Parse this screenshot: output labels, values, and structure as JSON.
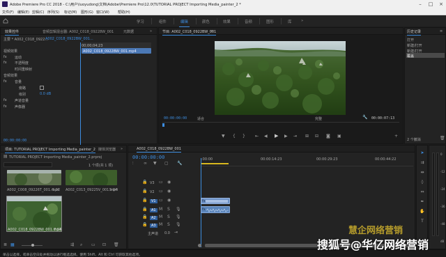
{
  "titlebar": {
    "title": "Adobe Premiere Pro CC 2018 - C:\\用户\\luoyudong\\文档\\Adobe\\Premiere Pro\\12.0\\TUTORIAL PROJECT Importing Media_painter_2 *"
  },
  "menu": [
    "文件(F)",
    "编辑(E)",
    "剪辑(C)",
    "序列(S)",
    "标记(M)",
    "图形(G)",
    "窗口(W)",
    "帮助(H)"
  ],
  "workspaces": {
    "tabs": [
      "学习",
      "组件",
      "编辑",
      "颜色",
      "效果",
      "音频",
      "图形",
      "库"
    ],
    "active": "编辑",
    "more": "»"
  },
  "effect_controls": {
    "tabs": [
      "效果控件",
      "音频剪辑混合器: A002_C018_09228W_001",
      "元数据"
    ],
    "more": "»",
    "source": "主要 * A002_C018_0922...",
    "clip": "A002_C018_0922BW_001...",
    "mini_clip": "A002_C018_0922BW_001.mp4",
    "mini_tc": "00;00;04;23",
    "sections": [
      "视频效果",
      "运动",
      "不透明度",
      "时间重映射",
      "音频效果",
      "音量",
      "旁路",
      "级别",
      "声道音量",
      "声像器"
    ],
    "fx": "fx",
    "level_value": "0.0 dB",
    "timecode": "00:00:00:00"
  },
  "program": {
    "tab": "节目: A002_C018_0922BW_001",
    "menu_icon": "≡",
    "timecode": "00:00:00:00",
    "fit": "适合",
    "quality": "完整",
    "duration": "00:00:07:13"
  },
  "history": {
    "tab": "历史记录",
    "menu_icon": "≡",
    "items": [
      "打开",
      "新建/打开",
      "新建/打开",
      "覆盖"
    ],
    "undo": "2 个撤消"
  },
  "project": {
    "tabs": [
      "项目: TUTORIAL PROJECT Importing Media_painter_2",
      "媒体浏览器"
    ],
    "more": "»",
    "file": "TUTORIAL PROJECT Importing Media_painter_2.prproj",
    "selection": "1 个项(共 1 项)",
    "clips": [
      {
        "name": "A002_C008_09226T_001.mp4",
        "dur": "5:12"
      },
      {
        "name": "A002_C013_09225V_001.mp4",
        "dur": "5:04"
      },
      {
        "name": "A002_C018_0922BW_001.mp4",
        "dur": "7:13"
      }
    ]
  },
  "timeline": {
    "tab": "A002_C018_0922BW_001",
    "timecode": "00:00:00:00",
    "ruler": [
      ":00:00",
      "00:00:14:23",
      "00:00:29:23",
      "00:00:44:22"
    ],
    "tracks": [
      "V3",
      "V2",
      "V1",
      "A1",
      "A2",
      "A3"
    ],
    "master": "主声道",
    "master_val": "0.0",
    "clip_label": "fx",
    "db_labels": [
      "0",
      "-12",
      "-24",
      "-36",
      "-48",
      "dB"
    ]
  },
  "status": "单击以选择，或单击空白处并拖动以进行框选选择。使用 Shift、Alt 和 Ctrl 可获取其他选项。",
  "watermark": {
    "text": "搜狐号@华亿网络营销",
    "logo": "慧企网络营销"
  }
}
